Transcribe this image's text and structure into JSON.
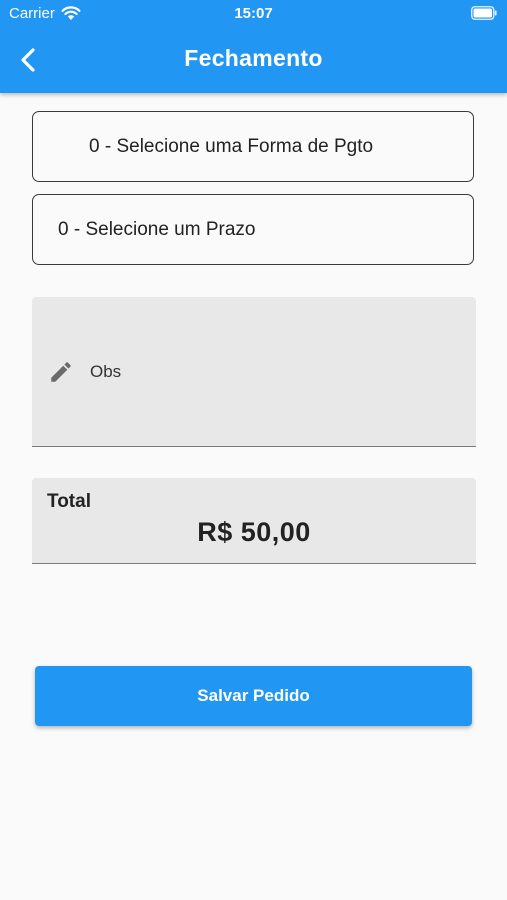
{
  "status_bar": {
    "carrier": "Carrier",
    "time": "15:07"
  },
  "header": {
    "title": "Fechamento",
    "back_icon": "chevron-left-icon"
  },
  "form": {
    "payment_select_value": "0 - Selecione uma Forma de Pgto",
    "term_select_value": "0 - Selecione um Prazo",
    "obs_label": "Obs",
    "obs_icon": "pencil-icon"
  },
  "total": {
    "label": "Total",
    "value": "R$ 50,00"
  },
  "actions": {
    "save_label": "Salvar Pedido"
  },
  "colors": {
    "primary": "#2196f3",
    "background": "#fafafa",
    "field_fill": "#e8e8e8"
  }
}
